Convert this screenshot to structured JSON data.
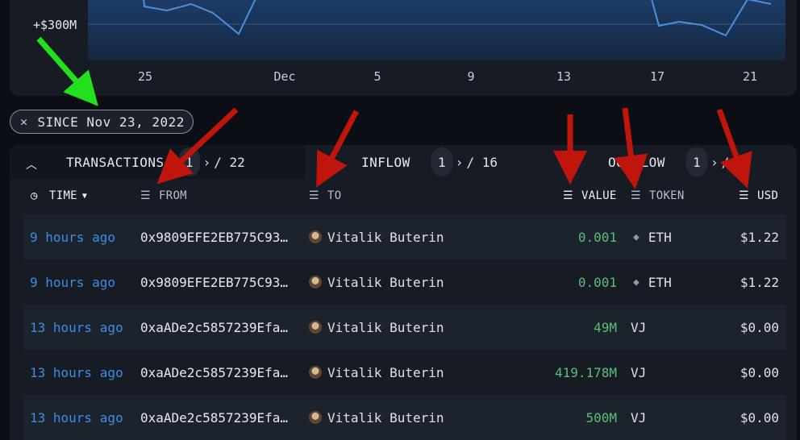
{
  "chart": {
    "y_label": "+$300M",
    "x_ticks": [
      "25",
      "Dec",
      "5",
      "9",
      "13",
      "17",
      "21"
    ]
  },
  "filter_chip": {
    "close_icon": "close-icon",
    "label": "SINCE Nov 23, 2022"
  },
  "tabs": [
    {
      "label": "TRANSACTIONS",
      "page": "1",
      "total": "/ 22"
    },
    {
      "label": "INFLOW",
      "page": "1",
      "total": "/ 16"
    },
    {
      "label": "OUTFLOW",
      "page": "1",
      "total": "/"
    }
  ],
  "headers": {
    "time": "TIME",
    "from": "FROM",
    "to": "TO",
    "value": "VALUE",
    "token": "TOKEN",
    "usd": "USD"
  },
  "rows": [
    {
      "time": "9 hours ago",
      "from": "0x9809EFE2EB775C93…",
      "to": "Vitalik Buterin",
      "value": "0.001",
      "token": "ETH",
      "usd": "$1.22"
    },
    {
      "time": "9 hours ago",
      "from": "0x9809EFE2EB775C93…",
      "to": "Vitalik Buterin",
      "value": "0.001",
      "token": "ETH",
      "usd": "$1.22"
    },
    {
      "time": "13 hours ago",
      "from": "0xaADe2c5857239Efa…",
      "to": "Vitalik Buterin",
      "value": "49M",
      "token": "VJ",
      "usd": "$0.00"
    },
    {
      "time": "13 hours ago",
      "from": "0xaADe2c5857239Efa…",
      "to": "Vitalik Buterin",
      "value": "419.178M",
      "token": "VJ",
      "usd": "$0.00"
    },
    {
      "time": "13 hours ago",
      "from": "0xaADe2c5857239Efa…",
      "to": "Vitalik Buterin",
      "value": "500M",
      "token": "VJ",
      "usd": "$0.00"
    }
  ],
  "colors": {
    "accent_time": "#3b8de6",
    "value_green": "#5bbf7a",
    "annotation_red": "#c0150c",
    "annotation_green": "#22e11c"
  }
}
